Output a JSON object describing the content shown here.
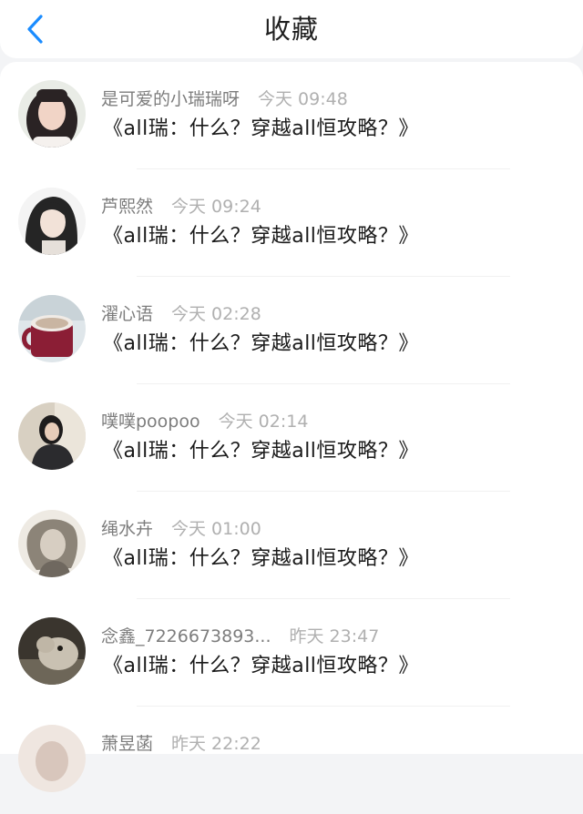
{
  "header": {
    "title": "收藏"
  },
  "items": [
    {
      "name": "是可爱的小瑞瑞呀",
      "time": "今天 09:48",
      "content": "《all瑞：什么？穿越all恒攻略？》"
    },
    {
      "name": "芦熙然",
      "time": "今天 09:24",
      "content": "《all瑞：什么？穿越all恒攻略？》"
    },
    {
      "name": "濯心语",
      "time": "今天 02:28",
      "content": "《all瑞：什么？穿越all恒攻略？》"
    },
    {
      "name": "噗噗poopoo",
      "time": "今天 02:14",
      "content": "《all瑞：什么？穿越all恒攻略？》"
    },
    {
      "name": "绳水卉",
      "time": "今天 01:00",
      "content": "《all瑞：什么？穿越all恒攻略？》"
    },
    {
      "name": "念鑫_7226673893...",
      "time": "昨天 23:47",
      "content": "《all瑞：什么？穿越all恒攻略？》"
    },
    {
      "name": "萧昱菡",
      "time": "昨天 22:22",
      "content": ""
    }
  ],
  "colors": {
    "accent": "#1a8cff",
    "name": "#7d7d7d",
    "time": "#b0b0b0",
    "text": "#1a1a1a"
  }
}
